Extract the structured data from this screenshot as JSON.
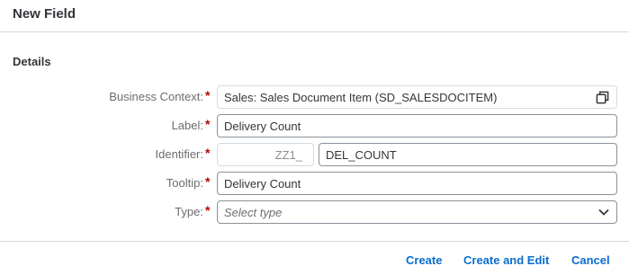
{
  "dialog": {
    "title": "New Field"
  },
  "section": {
    "title": "Details"
  },
  "fields": {
    "business_context": {
      "label": "Business Context:",
      "required": "*",
      "value": "Sales: Sales Document Item (SD_SALESDOCITEM)",
      "icon": "value-help-icon"
    },
    "label": {
      "label": "Label:",
      "required": "*",
      "value": "Delivery Count"
    },
    "identifier": {
      "label": "Identifier:",
      "required": "*",
      "prefix": "ZZ1_",
      "value": "DEL_COUNT"
    },
    "tooltip": {
      "label": "Tooltip:",
      "required": "*",
      "value": "Delivery Count"
    },
    "type": {
      "label": "Type:",
      "required": "*",
      "placeholder": "Select type",
      "icon": "chevron-down-icon"
    }
  },
  "footer": {
    "create_label": "Create",
    "create_edit_label": "Create and Edit",
    "cancel_label": "Cancel"
  },
  "colors": {
    "accent": "#0a6ed1",
    "required": "#bb0000"
  }
}
